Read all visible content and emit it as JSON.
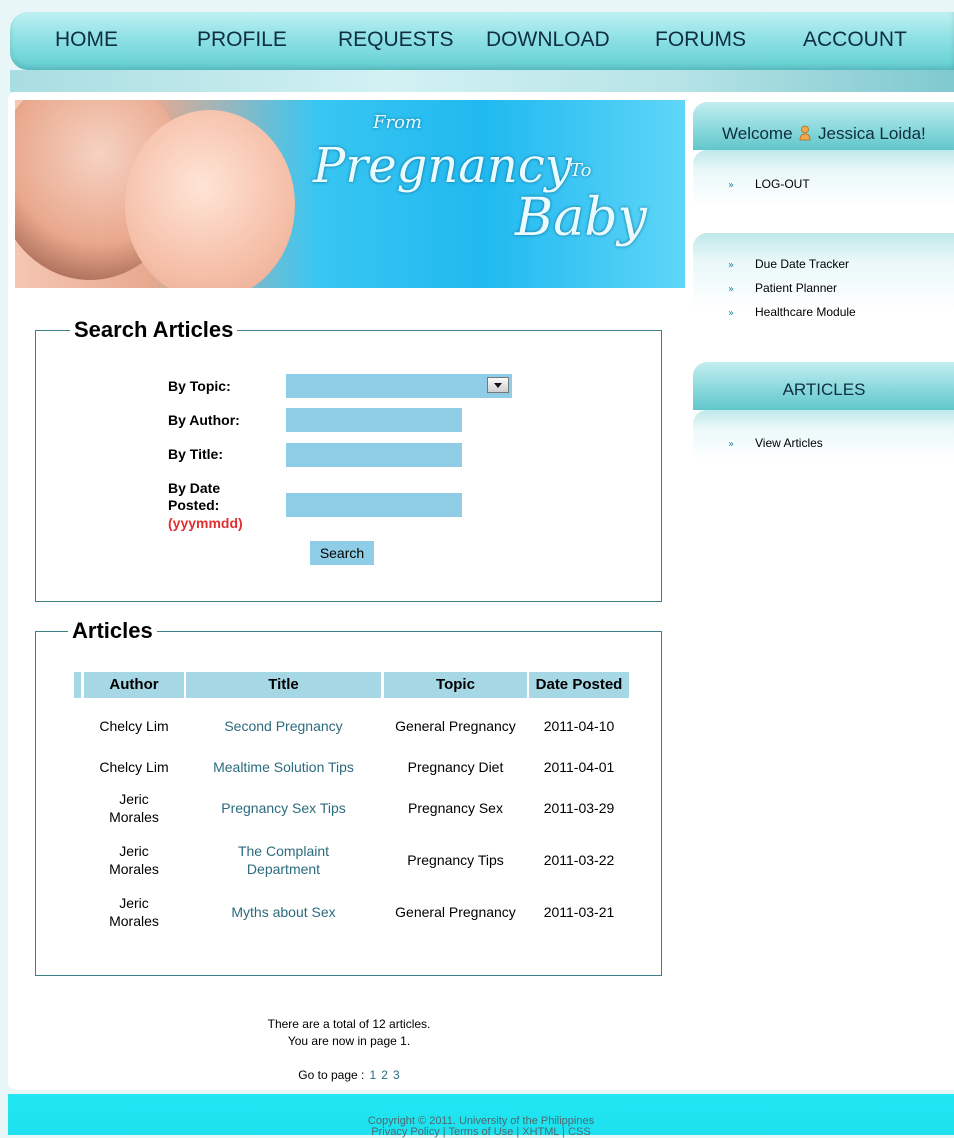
{
  "nav": {
    "items": [
      "HOME",
      "PROFILE",
      "REQUESTS",
      "DOWNLOAD",
      "FORUMS",
      "ACCOUNT"
    ]
  },
  "banner": {
    "from": "From",
    "pregnancy": "Pregnancy",
    "to": "To",
    "baby": "Baby"
  },
  "sidebar": {
    "welcome_prefix": "Welcome",
    "user_icon": "user-icon",
    "user_name": "Jessica Loida!",
    "logout": "LOG-OUT",
    "tools": [
      "Due Date Tracker",
      "Patient Planner",
      "Healthcare Module"
    ],
    "articles_header": "ARTICLES",
    "view_articles": "View Articles",
    "bullet": "»"
  },
  "search": {
    "legend": "Search Articles",
    "by_topic": "By Topic:",
    "by_author": "By Author:",
    "by_title": "By Title:",
    "by_date_line1": "By Date",
    "by_date_line2": "Posted:",
    "date_format": "(yyymmdd)",
    "button": "Search"
  },
  "articles": {
    "legend": "Articles",
    "headers": [
      "Author",
      "Title",
      "Topic",
      "Date Posted"
    ],
    "rows": [
      {
        "author": "Chelcy Lim",
        "title": "Second Pregnancy",
        "topic": "General Pregnancy",
        "date": "2011-04-10"
      },
      {
        "author": "Chelcy Lim",
        "title": "Mealtime Solution Tips",
        "topic": "Pregnancy Diet",
        "date": "2011-04-01"
      },
      {
        "author": "Jeric Morales",
        "title": "Pregnancy Sex Tips",
        "topic": "Pregnancy Sex",
        "date": "2011-03-29"
      },
      {
        "author": "Jeric Morales",
        "title": "The Complaint Department",
        "topic": "Pregnancy Tips",
        "date": "2011-03-22"
      },
      {
        "author": "Jeric Morales",
        "title": "Myths about Sex",
        "topic": "General Pregnancy",
        "date": "2011-03-21"
      }
    ]
  },
  "pagination": {
    "total_text": "There are a total of 12 articles.",
    "current_text": "You are now in page 1.",
    "goto_label": "Go to page :",
    "pages": [
      "1",
      "2",
      "3"
    ]
  },
  "footer": {
    "line1": "Copyright © 2011. University of the Philippines",
    "line2": "Privacy Policy | Terms of Use | XHTML | CSS"
  },
  "colors": {
    "accent": "#62cfd3",
    "field_bg": "#8fcde6",
    "header_bg": "#a6d7e4",
    "link": "#2b6b7e",
    "date_hint": "#e03131",
    "footer": "#21e7f3"
  }
}
